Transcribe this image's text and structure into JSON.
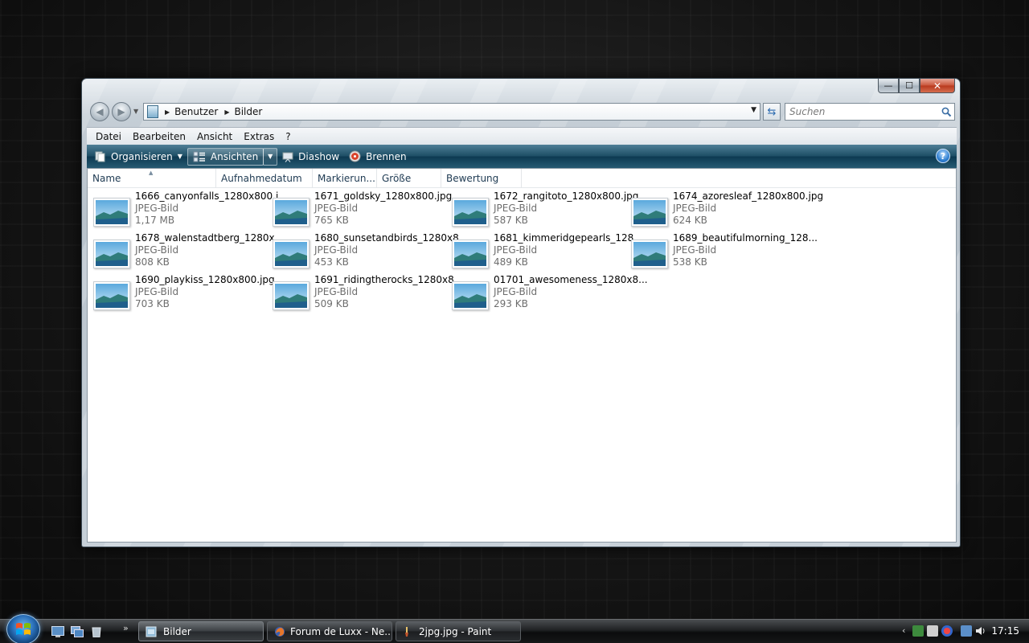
{
  "window": {
    "title_buttons": {
      "minimize": "—",
      "maximize": "☐",
      "close": "✕"
    },
    "breadcrumbs": [
      "Benutzer",
      "Bilder"
    ],
    "search": {
      "placeholder": "Suchen",
      "value": ""
    },
    "menu": [
      "Datei",
      "Bearbeiten",
      "Ansicht",
      "Extras",
      "?"
    ],
    "toolbar": {
      "organize": "Organisieren",
      "views": "Ansichten",
      "slideshow": "Diashow",
      "burn": "Brennen",
      "help": "?"
    },
    "columns": [
      "Name",
      "Aufnahmedatum",
      "Markierun...",
      "Größe",
      "Bewertung"
    ],
    "files": [
      {
        "name": "1666_canyonfalls_1280x800.j...",
        "type": "JPEG-Bild",
        "size": "1,17 MB"
      },
      {
        "name": "1671_goldsky_1280x800.jpg",
        "type": "JPEG-Bild",
        "size": "765 KB"
      },
      {
        "name": "1672_rangitoto_1280x800.jpg",
        "type": "JPEG-Bild",
        "size": "587 KB"
      },
      {
        "name": "1674_azoresleaf_1280x800.jpg",
        "type": "JPEG-Bild",
        "size": "624 KB"
      },
      {
        "name": "1678_walenstadtberg_1280x...",
        "type": "JPEG-Bild",
        "size": "808 KB"
      },
      {
        "name": "1680_sunsetandbirds_1280x8...",
        "type": "JPEG-Bild",
        "size": "453 KB"
      },
      {
        "name": "1681_kimmeridgepearls_128...",
        "type": "JPEG-Bild",
        "size": "489 KB"
      },
      {
        "name": "1689_beautifulmorning_128...",
        "type": "JPEG-Bild",
        "size": "538 KB"
      },
      {
        "name": "1690_playkiss_1280x800.jpg",
        "type": "JPEG-Bild",
        "size": "703 KB"
      },
      {
        "name": "1691_ridingtherocks_1280x8...",
        "type": "JPEG-Bild",
        "size": "509 KB"
      },
      {
        "name": "01701_awesomeness_1280x8...",
        "type": "JPEG-Bild",
        "size": "293 KB"
      }
    ]
  },
  "taskbar": {
    "quicklaunch_more": "»",
    "tasks": [
      {
        "label": "Bilder",
        "icon": "folder-icon"
      },
      {
        "label": "Forum de Luxx - Ne...",
        "icon": "firefox-icon"
      },
      {
        "label": "2jpg.jpg - Paint",
        "icon": "paint-icon"
      }
    ],
    "tray_expand": "‹",
    "clock": "17:15"
  },
  "colors": {
    "toolbar": "#1e4f66",
    "desktop": "#121212",
    "start_orb": "#2a6fb8"
  }
}
